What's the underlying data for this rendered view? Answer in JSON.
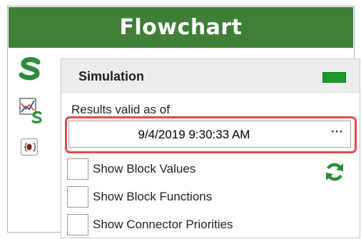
{
  "window": {
    "title": "Flowchart"
  },
  "toolbar": {
    "icons": [
      "simulation-s-icon",
      "chart-icon",
      "debug-bug-icon"
    ]
  },
  "simulation": {
    "title": "Simulation",
    "status_color": "#1e9a2a",
    "results_label": "Results valid as of",
    "results_datetime": "9/4/2019 9:30:33 AM",
    "browse_label": "···",
    "options": [
      {
        "label": "Show Block Values",
        "checked": false
      },
      {
        "label": "Show Block Functions",
        "checked": false
      },
      {
        "label": "Show Connector Priorities",
        "checked": false
      }
    ],
    "refresh_icon": "refresh-icon"
  },
  "colors": {
    "title_bar": "#3f7f37",
    "highlight": "#e04a4f",
    "accent_green": "#2e8b3a"
  }
}
